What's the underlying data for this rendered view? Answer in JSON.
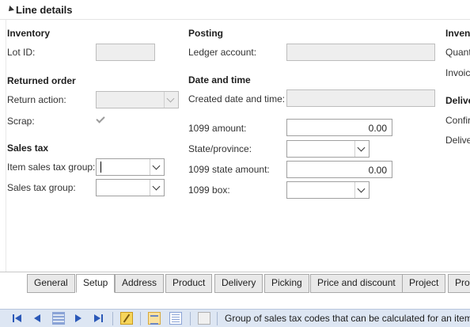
{
  "section": {
    "title": "Line details"
  },
  "inventory": {
    "title": "Inventory",
    "lot_id_label": "Lot ID:",
    "lot_id_value": ""
  },
  "returned_order": {
    "title": "Returned order",
    "return_action_label": "Return action:",
    "return_action_value": "",
    "scrap_label": "Scrap:",
    "scrap_checked": true
  },
  "sales_tax": {
    "title": "Sales tax",
    "item_group_label": "Item sales tax group:",
    "item_group_value": "",
    "group_label": "Sales tax group:",
    "group_value": ""
  },
  "posting": {
    "title": "Posting",
    "ledger_account_label": "Ledger account:",
    "ledger_account_value": ""
  },
  "date_time": {
    "title": "Date and time",
    "created_label": "Created date and time:",
    "created_value": ""
  },
  "form1099": {
    "amount_label": "1099 amount:",
    "amount_value": "0.00",
    "state_label": "State/province:",
    "state_value": "",
    "state_amount_label": "1099 state amount:",
    "state_amount_value": "0.00",
    "box_label": "1099 box:",
    "box_value": ""
  },
  "right_column_cut": {
    "title1": "Inven",
    "quant": "Quant",
    "invoic": "Invoic",
    "title2": "Delive",
    "confir": "Confir",
    "delive": "Delive"
  },
  "tabs": [
    {
      "label": "General"
    },
    {
      "label": "Setup",
      "active": true
    },
    {
      "label": "Address"
    },
    {
      "label": "Product"
    },
    {
      "label": "Delivery"
    },
    {
      "label": "Picking"
    },
    {
      "label": "Price and discount"
    },
    {
      "label": "Project"
    },
    {
      "label": "Proc"
    }
  ],
  "statusbar": {
    "icons": [
      "first-record-icon",
      "previous-record-icon",
      "grid-icon",
      "next-record-icon",
      "last-record-icon",
      "edit-icon",
      "form-view-icon",
      "list-view-icon",
      "attachment-icon"
    ],
    "text": "Group of sales tax codes that can be calculated for an item"
  }
}
